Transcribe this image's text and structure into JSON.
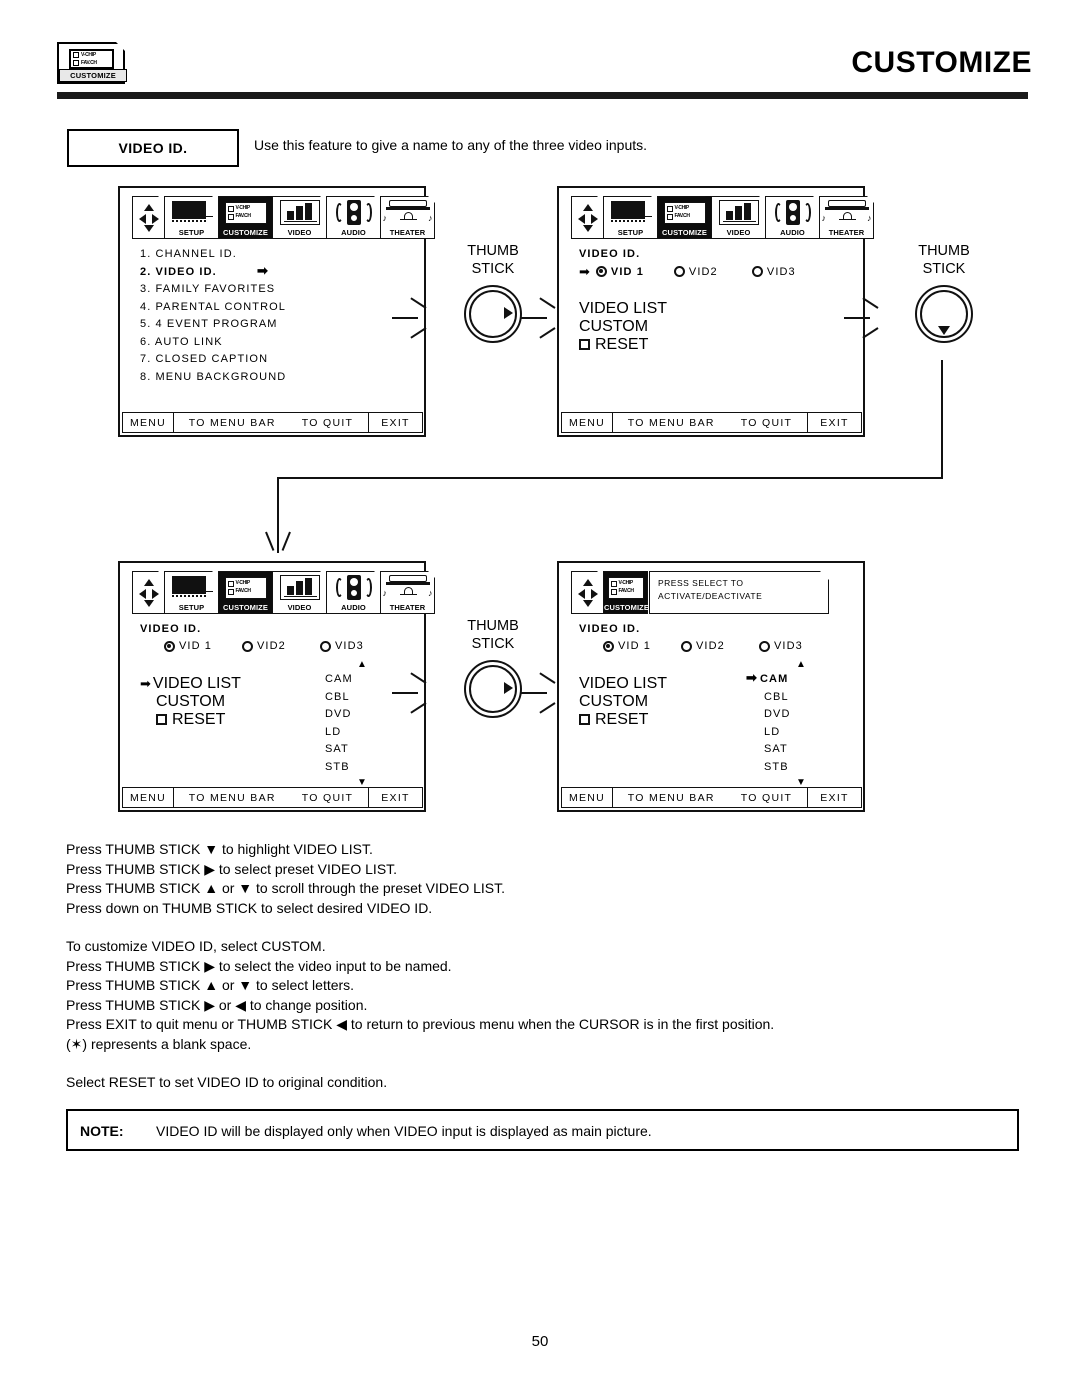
{
  "header": {
    "title": "CUSTOMIZE",
    "logo": {
      "line1": "V-CHIP",
      "line2": "FAV.CH",
      "caption": "CUSTOMIZE"
    }
  },
  "intro": {
    "box_label": "VIDEO ID.",
    "description": "Use this feature to give a name to any of the three video inputs."
  },
  "menu_tabs": [
    {
      "label": "SETUP",
      "icon": "tv-icon"
    },
    {
      "label": "CUSTOMIZE",
      "icon": "vchip-icon",
      "active": true
    },
    {
      "label": "VIDEO",
      "icon": "video-bars-icon"
    },
    {
      "label": "AUDIO",
      "icon": "speaker-icon"
    },
    {
      "label": "THEATER",
      "icon": "theater-icon"
    }
  ],
  "vchip_icon": {
    "line1": "V-CHIP",
    "line2": "FAV.CH"
  },
  "osd_footer": {
    "menu": "MENU",
    "to_menu_bar": "TO MENU BAR",
    "to_quit": "TO QUIT",
    "exit": "EXIT"
  },
  "panel1": {
    "items": [
      "1. CHANNEL ID.",
      "2. VIDEO ID.",
      "3. FAMILY FAVORITES",
      "4. PARENTAL CONTROL",
      "5. 4 EVENT PROGRAM",
      "6. AUTO LINK",
      "7. CLOSED CAPTION",
      "8. MENU BACKGROUND"
    ],
    "selected_index": 1,
    "cursor": "➡"
  },
  "panel2": {
    "title": "VIDEO ID.",
    "cursor": "➡",
    "inputs": [
      {
        "label": "VID 1",
        "selected": true
      },
      {
        "label": "VID2",
        "selected": false
      },
      {
        "label": "VID3",
        "selected": false
      }
    ],
    "options": [
      "VIDEO LIST",
      "CUSTOM"
    ],
    "reset_label": "RESET"
  },
  "panel3": {
    "title": "VIDEO ID.",
    "cursor": "➡",
    "inputs": [
      {
        "label": "VID 1",
        "selected": true
      },
      {
        "label": "VID2",
        "selected": false
      },
      {
        "label": "VID3",
        "selected": false
      }
    ],
    "options": [
      "VIDEO  LIST",
      "CUSTOM"
    ],
    "highlighted_option": "VIDEO  LIST",
    "reset_label": "RESET",
    "list": {
      "scroll_up": "▲",
      "scroll_down": "▼",
      "items": [
        "CAM",
        "CBL",
        "DVD",
        "LD",
        "SAT",
        "STB"
      ],
      "highlighted": null
    }
  },
  "panel4": {
    "title": "VIDEO ID.",
    "cursor": "➡",
    "caption": {
      "line1": "PRESS SELECT TO",
      "line2": "ACTIVATE/DEACTIVATE"
    },
    "tab_label": "CUSTOMIZE",
    "inputs": [
      {
        "label": "VID 1",
        "selected": true
      },
      {
        "label": "VID2",
        "selected": false
      },
      {
        "label": "VID3",
        "selected": false
      }
    ],
    "options": [
      "VIDEO  LIST",
      "CUSTOM"
    ],
    "reset_label": "RESET",
    "list": {
      "scroll_up": "▲",
      "scroll_down": "▼",
      "items": [
        "CAM",
        "CBL",
        "DVD",
        "LD",
        "SAT",
        "STB"
      ],
      "highlighted": "CAM"
    }
  },
  "thumbsticks": [
    {
      "line1": "THUMB",
      "line2": "STICK",
      "direction": "right"
    },
    {
      "line1": "THUMB",
      "line2": "STICK",
      "direction": "down"
    },
    {
      "line1": "THUMB",
      "line2": "STICK",
      "direction": "right"
    }
  ],
  "instructions": [
    "Press THUMB STICK ▼ to highlight VIDEO LIST.",
    "Press THUMB STICK ▶ to select preset VIDEO LIST.",
    "Press THUMB STICK ▲ or ▼ to scroll through the preset VIDEO LIST.",
    "Press down on THUMB STICK to select desired VIDEO ID.",
    "",
    "To customize VIDEO ID, select CUSTOM.",
    "Press THUMB STICK ▶ to select the video input to be named.",
    "Press THUMB STICK ▲ or ▼ to select letters.",
    "Press THUMB STICK ▶ or ◀ to change position.",
    "Press EXIT to quit menu or THUMB STICK ◀ to return to previous menu when the CURSOR is in the first position.",
    "(✶) represents a blank space.",
    "",
    "Select RESET to set VIDEO ID to original condition."
  ],
  "note": {
    "label": "NOTE:",
    "text": "VIDEO ID will be displayed only when VIDEO input is displayed as main picture."
  },
  "page_number": "50"
}
